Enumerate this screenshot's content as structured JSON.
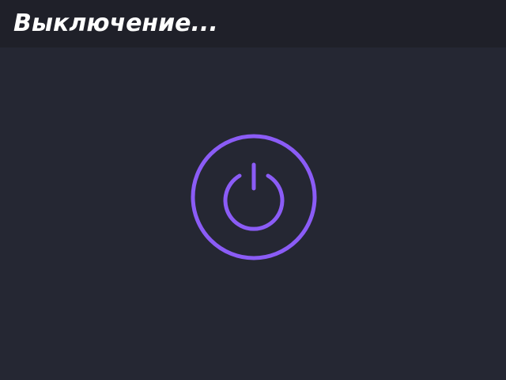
{
  "header": {
    "title": "Выключение..."
  },
  "power_indicator": {
    "icon": "power-icon",
    "color": "#8b5cf6"
  },
  "colors": {
    "background": "#252733",
    "header_background": "#1f2029",
    "title_text": "#ffffff",
    "accent": "#8b5cf6"
  }
}
